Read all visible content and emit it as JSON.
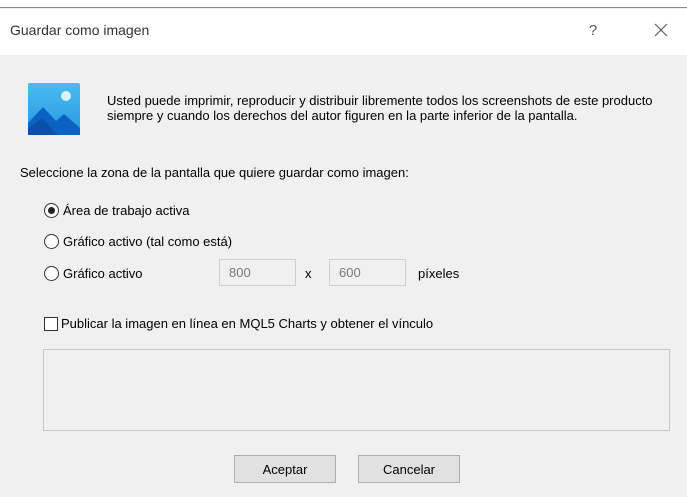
{
  "window": {
    "title": "Guardar como imagen",
    "help_glyph": "?",
    "close_glyph": "close-icon"
  },
  "notice": {
    "icon": "image-icon",
    "text": "Usted puede imprimir, reproducir y distribuir libremente todos los screenshots de este producto siempre y cuando los derechos del autor figuren en la parte inferior de la pantalla."
  },
  "selection": {
    "label": "Seleccione la zona de la pantalla que quiere guardar como imagen:",
    "options": [
      {
        "label": "Área de trabajo activa",
        "checked": true
      },
      {
        "label": "Gráfico activo (tal como está)",
        "checked": false
      },
      {
        "label": "Gráfico activo",
        "checked": false
      }
    ],
    "width_value": "800",
    "separator": "x",
    "height_value": "600",
    "unit": "píxeles"
  },
  "publish": {
    "label": "Publicar la imagen en línea en MQL5 Charts y obtener el vínculo",
    "checked": false,
    "link_value": ""
  },
  "buttons": {
    "accept": "Aceptar",
    "cancel": "Cancelar"
  },
  "colors": {
    "icon_light": "#3fb4ee",
    "icon_dark": "#0a64c4",
    "dialog_bg": "#f0f0f0"
  }
}
